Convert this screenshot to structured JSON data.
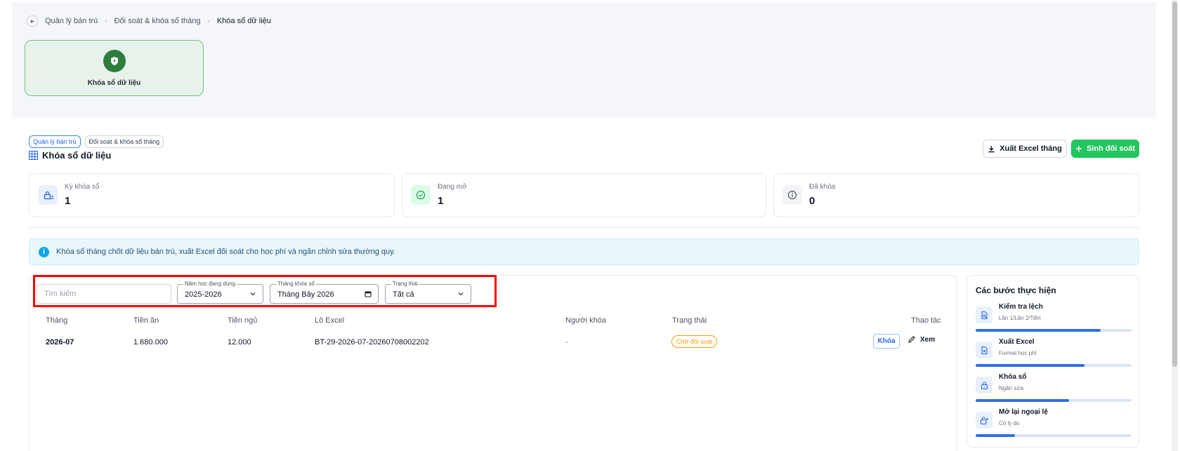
{
  "breadcrumb": {
    "items": [
      "Quản lý bán trú",
      "Đối soát & khóa sổ tháng"
    ],
    "current": "Khóa sổ dữ liệu"
  },
  "module_card": {
    "label": "Khóa sổ dữ liệu"
  },
  "tags": [
    "Quản lý bán trú",
    "Đối soát & khóa sổ tháng"
  ],
  "page_title": "Khóa sổ dữ liệu",
  "actions": {
    "export_label": "Xuất Excel tháng",
    "generate_label": "Sinh đối soát"
  },
  "stats": [
    {
      "label": "Kỳ khóa sổ",
      "value": "1",
      "icon": "lock-refresh-icon",
      "color": "#2563eb"
    },
    {
      "label": "Đang mở",
      "value": "1",
      "icon": "check-circle-icon",
      "color": "#16a34a"
    },
    {
      "label": "Đã khóa",
      "value": "0",
      "icon": "info-circle-icon",
      "color": "#6b7280"
    }
  ],
  "info_banner": {
    "text": "Khóa sổ tháng chốt dữ liệu bán trú, xuất Excel đối soát cho học phí và ngăn chỉnh sửa thường quy."
  },
  "filters": {
    "search_placeholder": "Tìm kiếm",
    "school_year": {
      "label": "Năm học đang dùng",
      "value": "2025-2026"
    },
    "month": {
      "label": "Tháng khóa sổ",
      "value": "Tháng Bảy 2026"
    },
    "status": {
      "label": "Trạng thái",
      "value": "Tất cả"
    }
  },
  "table": {
    "headers": [
      "Tháng",
      "Tiền ăn",
      "Tiền ngủ",
      "Lô Excel",
      "Người khóa",
      "Trạng thái",
      "Thao tác"
    ],
    "rows": [
      {
        "month": "2026-07",
        "meal_fee": "1.680.000",
        "nap_fee": "12.000",
        "batch": "BT-29-2026-07-20260708002202",
        "locked_by": "-",
        "status": "Chờ đối soát",
        "lock_label": "Khóa",
        "view_label": "Xem"
      }
    ]
  },
  "steps": {
    "title": "Các bước thực hiện",
    "items": [
      {
        "title": "Kiểm tra lệch",
        "subtitle": "Lần 1/Lần 2/Tiền",
        "progress": 0.8,
        "icon": "document-search-icon"
      },
      {
        "title": "Xuất Excel",
        "subtitle": "Format học phí",
        "progress": 0.7,
        "icon": "excel-file-icon"
      },
      {
        "title": "Khóa sổ",
        "subtitle": "Ngăn sửa",
        "progress": 0.6,
        "icon": "lock-icon"
      },
      {
        "title": "Mở lại ngoại lệ",
        "subtitle": "Có lý do",
        "progress": 0.25,
        "icon": "unlock-plus-icon"
      }
    ]
  },
  "colors": {
    "primary": "#2563eb",
    "success": "#22c55e",
    "warning": "#f59e0b",
    "module_green": "#2e7d3c"
  }
}
